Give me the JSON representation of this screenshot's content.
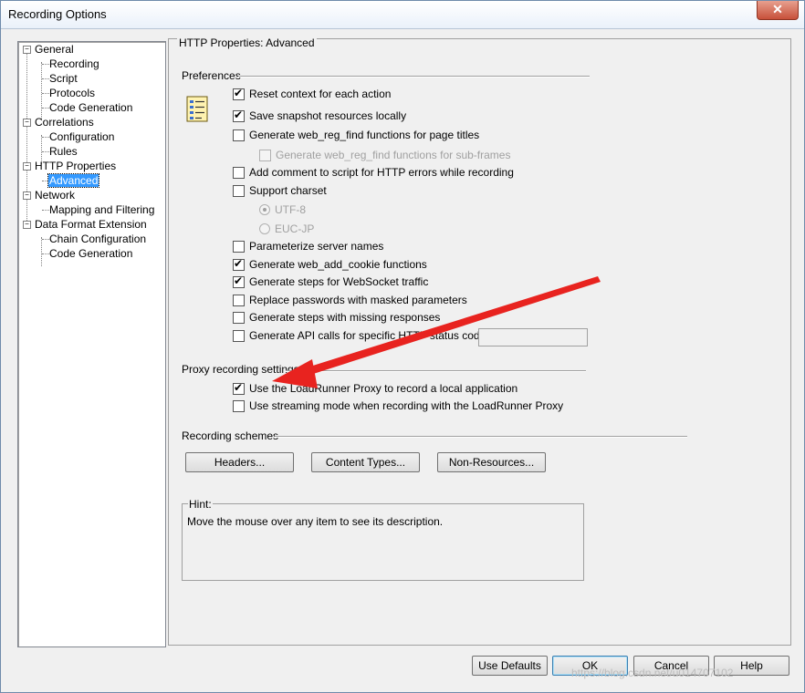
{
  "window": {
    "title": "Recording Options",
    "close_symbol": "✕"
  },
  "tree": {
    "nodes": [
      {
        "label": "General",
        "level": 0,
        "expander": "−"
      },
      {
        "label": "Recording",
        "level": 1
      },
      {
        "label": "Script",
        "level": 1
      },
      {
        "label": "Protocols",
        "level": 1
      },
      {
        "label": "Code Generation",
        "level": 1
      },
      {
        "label": "Correlations",
        "level": 0,
        "expander": "−"
      },
      {
        "label": "Configuration",
        "level": 1
      },
      {
        "label": "Rules",
        "level": 1
      },
      {
        "label": "HTTP Properties",
        "level": 0,
        "expander": "−"
      },
      {
        "label": "Advanced",
        "level": 1,
        "selected": true
      },
      {
        "label": "Network",
        "level": 0,
        "expander": "−"
      },
      {
        "label": "Mapping and Filtering",
        "level": 1
      },
      {
        "label": "Data Format Extension",
        "level": 0,
        "expander": "−"
      },
      {
        "label": "Chain Configuration",
        "level": 1
      },
      {
        "label": "Code Generation",
        "level": 1
      }
    ]
  },
  "panel": {
    "title": "HTTP Properties: Advanced"
  },
  "preferences": {
    "title": "Preferences",
    "options": [
      {
        "label": "Reset context for each action",
        "checked": true
      },
      {
        "label": "Save snapshot resources locally",
        "checked": true
      },
      {
        "label": "Generate web_reg_find functions for page titles",
        "checked": false
      },
      {
        "label": "Generate web_reg_find functions for sub-frames",
        "checked": false,
        "disabled": true
      },
      {
        "label": "Add comment to script for HTTP errors while recording",
        "checked": false
      },
      {
        "label": "Support charset",
        "checked": false
      },
      {
        "label": "Parameterize server names",
        "checked": false
      },
      {
        "label": "Generate web_add_cookie functions",
        "checked": true
      },
      {
        "label": "Generate steps for WebSocket traffic",
        "checked": true
      },
      {
        "label": "Replace passwords with masked parameters",
        "checked": false
      },
      {
        "label": "Generate steps with missing responses",
        "checked": false
      },
      {
        "label": "Generate API calls for specific HTTP status codes:",
        "checked": false
      }
    ],
    "charsets": [
      {
        "label": "UTF-8",
        "selected": true
      },
      {
        "label": "EUC-JP",
        "selected": false
      }
    ],
    "status_codes_value": ""
  },
  "proxy": {
    "title": "Proxy recording settings",
    "options": [
      {
        "label": "Use the LoadRunner Proxy to record a local application",
        "checked": true
      },
      {
        "label": "Use streaming mode when recording with the LoadRunner Proxy",
        "checked": false
      }
    ]
  },
  "schemes": {
    "title": "Recording schemes",
    "buttons": [
      "Headers...",
      "Content Types...",
      "Non-Resources..."
    ]
  },
  "hint": {
    "label": "Hint:",
    "text": "Move the mouse over any item to see its description."
  },
  "footer": {
    "buttons": [
      "Use Defaults",
      "OK",
      "Cancel",
      "Help"
    ]
  },
  "annotation": {
    "arrow_color": "#e8231f"
  },
  "watermark": "https://blog.csdn.net/u014707102"
}
